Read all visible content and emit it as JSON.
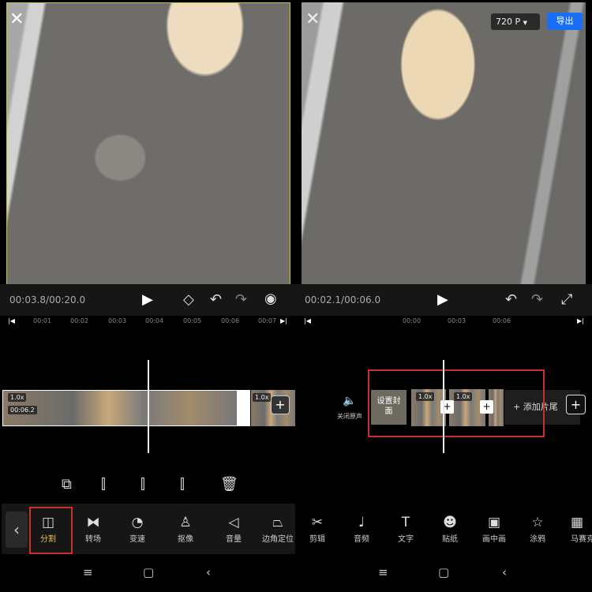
{
  "left": {
    "time": "00:03.8/00:20.0",
    "ruler": [
      "00:01",
      "00:02",
      "00:03",
      "00:04",
      "00:05",
      "00:06",
      "00:07"
    ],
    "clip_speed": "1.0x",
    "clip_duration": "00:06.2",
    "next_clip_speed": "1.0x",
    "edit_tools": [
      "copy",
      "split-left",
      "split",
      "split-right",
      "delete"
    ],
    "tools": [
      {
        "label": "分割",
        "icon": "split"
      },
      {
        "label": "转场",
        "icon": "transition"
      },
      {
        "label": "变速",
        "icon": "speed"
      },
      {
        "label": "抠像",
        "icon": "cutout"
      },
      {
        "label": "音量",
        "icon": "volume"
      },
      {
        "label": "边角定位",
        "icon": "corner"
      }
    ],
    "active_color": "#e6c34a"
  },
  "right": {
    "resolution": "720 P",
    "export": "导出",
    "export_color": "#1a6ef5",
    "time": "00:02.1/00:06.0",
    "ruler": [
      "00:00",
      "00:03",
      "00:06"
    ],
    "mute_label": "关闭原声",
    "cover_label": "设置封面",
    "clip_speed": "1.0x",
    "add_ending": "+ 添加片尾",
    "tools": [
      {
        "label": "剪辑",
        "icon": "scissors"
      },
      {
        "label": "音频",
        "icon": "music"
      },
      {
        "label": "文字",
        "icon": "text"
      },
      {
        "label": "贴纸",
        "icon": "sticker"
      },
      {
        "label": "画中画",
        "icon": "pip"
      },
      {
        "label": "涂鸦",
        "icon": "doodle"
      },
      {
        "label": "马赛克",
        "icon": "mosaic"
      }
    ]
  }
}
